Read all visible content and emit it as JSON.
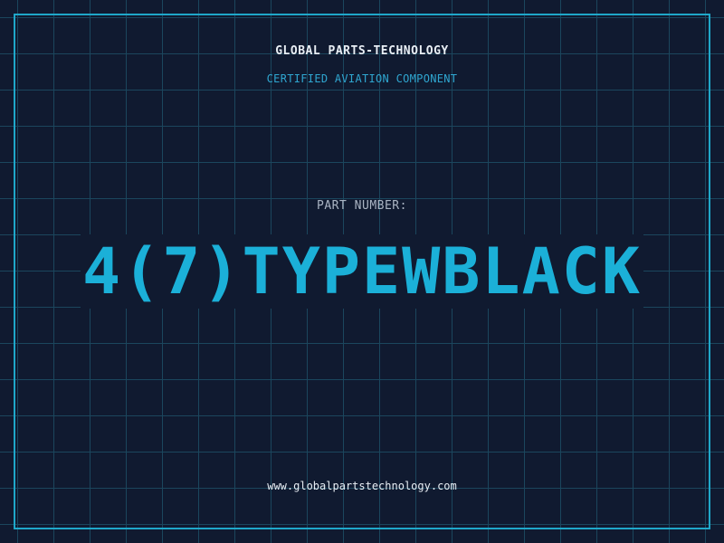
{
  "header": {
    "company": "GLOBAL PARTS-TECHNOLOGY",
    "subtitle": "CERTIFIED AVIATION COMPONENT"
  },
  "main": {
    "part_label": "PART NUMBER:",
    "part_number": "4(7)TYPEWBLACK"
  },
  "footer": {
    "website": "www.globalpartstechnology.com"
  },
  "colors": {
    "background": "#101a30",
    "grid": "#1d4e66",
    "accent": "#1bb0d8",
    "frame": "#1fa7c9"
  }
}
